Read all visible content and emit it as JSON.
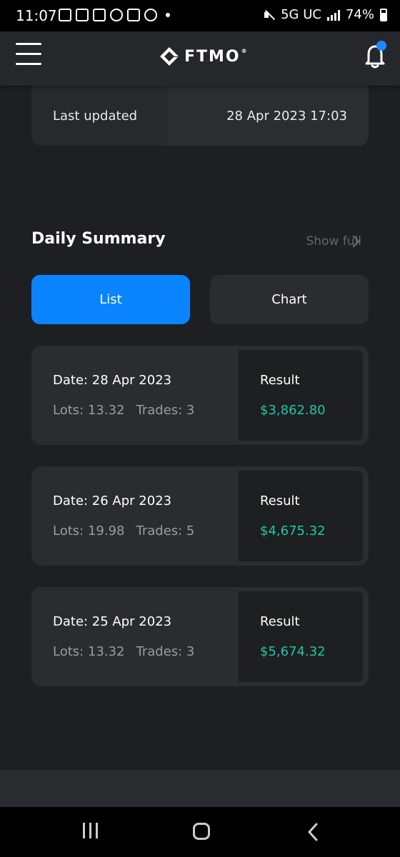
{
  "status_bar": {
    "time": "11:07",
    "network": "5G UC",
    "battery": "74%"
  },
  "header": {
    "logo_text": "FTMO",
    "logo_reg": "®",
    "notification_badge": true
  },
  "account_info": {
    "last_updated_label": "Last updated",
    "last_updated_value": "28 Apr 2023 17:03"
  },
  "daily_summary": {
    "title": "Daily Summary",
    "show_full_label": "Show full",
    "tabs": [
      {
        "label": "List",
        "active": true
      },
      {
        "label": "Chart",
        "active": false
      }
    ],
    "days": [
      {
        "date": "Date: 28 Apr 2023",
        "lots": "Lots: 13.32",
        "trades": "Trades: 3",
        "result_label": "Result",
        "result_value": "$3,862.80"
      },
      {
        "date": "Date: 26 Apr 2023",
        "lots": "Lots: 19.98",
        "trades": "Trades: 5",
        "result_label": "Result",
        "result_value": "$4,675.32"
      },
      {
        "date": "Date: 25 Apr 2023",
        "lots": "Lots: 13.32",
        "trades": "Trades: 3",
        "result_label": "Result",
        "result_value": "$5,674.32"
      }
    ]
  },
  "next_section": {
    "title": ""
  },
  "colors": {
    "background": "#1e1f22",
    "header": "#26272a",
    "card": "#2b2c30",
    "accent": "#0a84ff",
    "positive": "#1fc7a6",
    "badge": "#1e88ff"
  },
  "icons": {
    "menu": "hamburger-icon",
    "notifications": "bell-icon",
    "show_full": "chevron-right-icon",
    "nav_recent": "recent-apps-icon",
    "nav_home": "home-icon",
    "nav_back": "back-icon"
  }
}
